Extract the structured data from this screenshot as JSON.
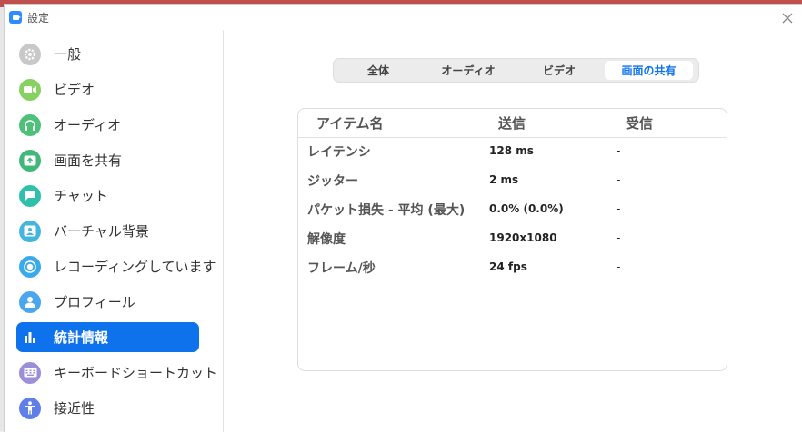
{
  "window": {
    "title": "設定"
  },
  "sidebar": {
    "items": [
      {
        "label": "一般",
        "color": "#c8c8c8"
      },
      {
        "label": "ビデオ",
        "color": "#86d160"
      },
      {
        "label": "オーディオ",
        "color": "#4fc07a"
      },
      {
        "label": "画面を共有",
        "color": "#3fb87a"
      },
      {
        "label": "チャット",
        "color": "#2fbfaa"
      },
      {
        "label": "バーチャル背景",
        "color": "#43b5de"
      },
      {
        "label": "レコーディングしています",
        "color": "#3aabe8"
      },
      {
        "label": "プロフィール",
        "color": "#4aa6ee"
      },
      {
        "label": "統計情報",
        "color": "#0e72ed",
        "active": true
      },
      {
        "label": "キーボードショートカット",
        "color": "#9c8ed8"
      },
      {
        "label": "接近性",
        "color": "#5f7ee8"
      }
    ]
  },
  "tabs": [
    {
      "label": "全体"
    },
    {
      "label": "オーディオ"
    },
    {
      "label": "ビデオ"
    },
    {
      "label": "画面の共有",
      "active": true
    }
  ],
  "stats": {
    "headers": {
      "item": "アイテム名",
      "send": "送信",
      "receive": "受信"
    },
    "rows": [
      {
        "label": "レイテンシ",
        "send": "128 ms",
        "receive": "-"
      },
      {
        "label": "ジッター",
        "send": "2 ms",
        "receive": "-"
      },
      {
        "label": "パケット損失 - 平均 (最大)",
        "send": "0.0% (0.0%)",
        "receive": "-"
      },
      {
        "label": "解像度",
        "send": "1920x1080",
        "receive": "-"
      },
      {
        "label": "フレーム/秒",
        "send": "24 fps",
        "receive": "-"
      }
    ]
  },
  "accent_color": "#0e72ed"
}
